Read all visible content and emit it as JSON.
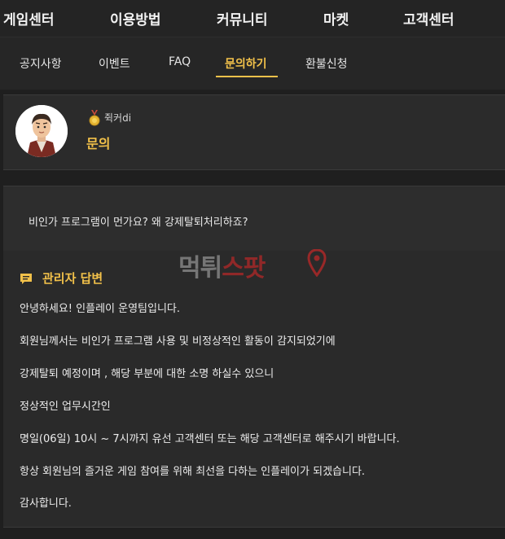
{
  "top_nav": {
    "items": [
      "게임센터",
      "이용방법",
      "커뮤니티",
      "마켓",
      "고객센터"
    ]
  },
  "sub_nav": {
    "tabs": [
      "공지사항",
      "이벤트",
      "FAQ",
      "문의하기",
      "환불신청"
    ],
    "active": "문의하기"
  },
  "post": {
    "author": "쥑커di",
    "title": "문의",
    "question": "비인가 프로그램이 먼가요? 왜 강제탈퇴처리하죠?"
  },
  "answer": {
    "title": "관리자 답변",
    "lines": [
      "안녕하세요! 인플레이 운영팀입니다.",
      "회원님께서는 비인가 프로그램 사용 및 비정상적인 활동이 감지되었기에",
      "강제탈퇴 예정이며 , 해당 부분에 대한 소명 하실수 있으니",
      "정상적인 업무시간인",
      "명일(06일) 10시 ~ 7시까지 유선 고객센터 또는 해당 고객센터로 해주시기 바랍니다.",
      "항상 회원님의 즐거운 게임 참여를 위해 최선을 다하는 인플레이가 되겠습니다.",
      "감사합니다."
    ]
  },
  "watermark": {
    "text_a": "먹튀",
    "text_b": "스팟"
  },
  "colors": {
    "accent": "#f2c14a",
    "background": "#1f1f1f",
    "panel": "#2a2a2a"
  }
}
